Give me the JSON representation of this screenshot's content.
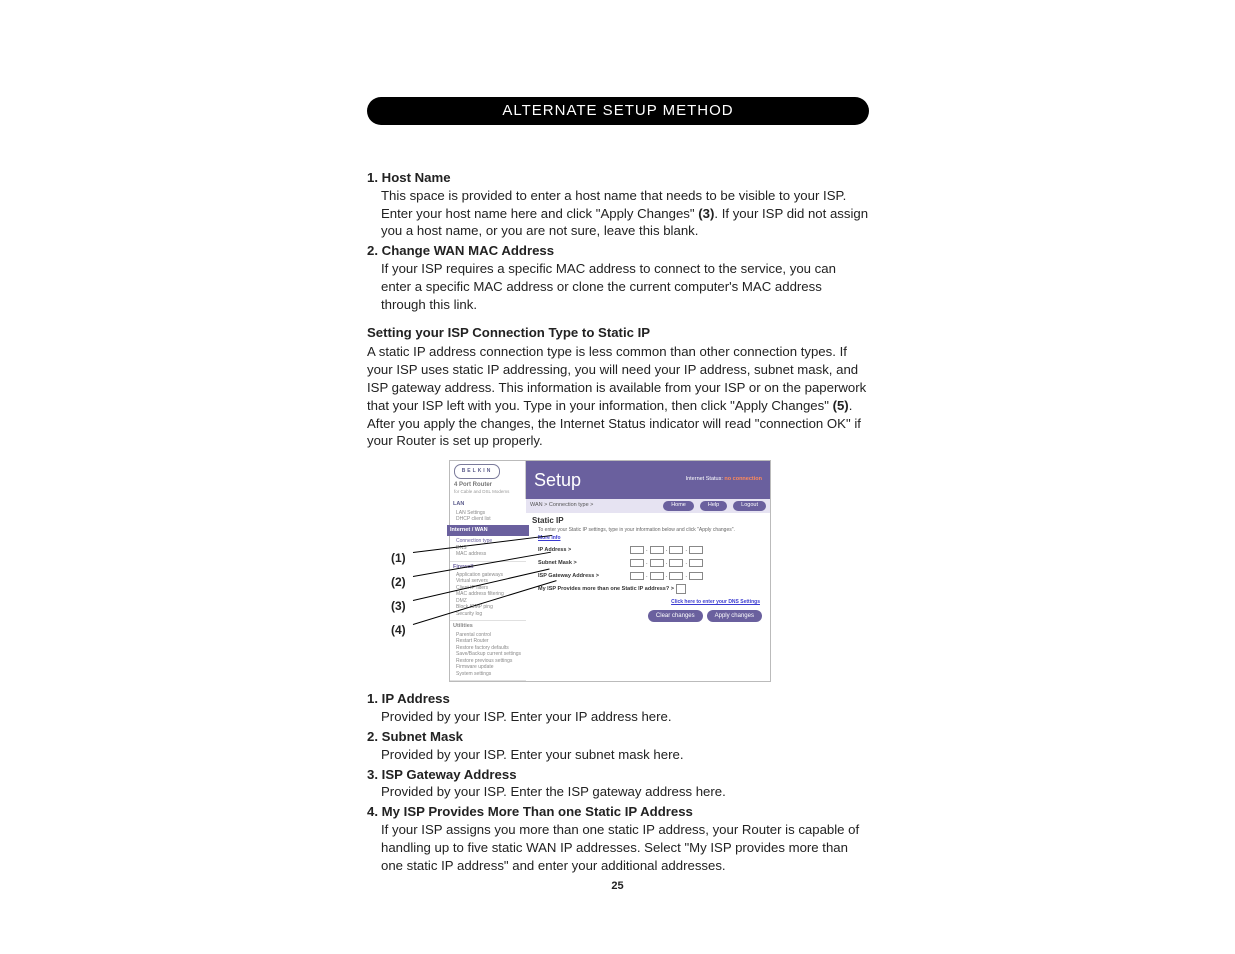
{
  "header": "ALTERNATE SETUP METHOD",
  "list1": {
    "i1": {
      "num": "1.",
      "title": "Host Name",
      "body_a": "This space is provided to enter a host name that needs to be visible to your ISP. Enter your host name here and click \"Apply Changes\" ",
      "ref": "(3)",
      "body_b": ". If your ISP did not assign you a host name, or you are not sure, leave this blank."
    },
    "i2": {
      "num": "2.",
      "title": "Change WAN MAC Address",
      "body": "If your ISP requires a specific MAC address to connect to the service, you can enter a specific MAC address or clone the current computer's MAC address through this link."
    }
  },
  "section": {
    "heading": "Setting your ISP Connection Type to Static IP",
    "p_a": "A static IP address connection type is less common than other connection types. If your ISP uses static IP addressing, you will need your IP address, subnet mask, and ISP gateway address. This information is available from your ISP or on the paperwork that your ISP left with you. Type in your information, then click \"Apply Changes\" ",
    "ref": "(5)",
    "p_b": ". After you apply the changes, the Internet Status indicator will read \"connection OK\" if your Router is set up properly."
  },
  "callouts": {
    "c1": "(1)",
    "c2": "(2)",
    "c3": "(3)",
    "c4": "(4)"
  },
  "router": {
    "logo": "BELKIN",
    "logo_sub": "4 Port Router",
    "logo_sub2": "for Cable and DSL Modems",
    "banner_title": "Setup",
    "status_label": "Internet Status:",
    "status_value": "no connection",
    "crumb": "WAN > Connection type >",
    "pills": {
      "home": "Home",
      "help": "Help",
      "logout": "Logout"
    },
    "side": {
      "lan": {
        "h": "LAN",
        "items": [
          "LAN Settings",
          "DHCP client list"
        ]
      },
      "wan": {
        "h": "Internet / WAN",
        "items": [
          "Connection type",
          "DNS",
          "MAC address"
        ]
      },
      "fw": {
        "h": "Firewall",
        "items": [
          "Application gateways",
          "Virtual servers",
          "Client IP filters",
          "MAC address filtering",
          "DMZ",
          "Block ICMP ping",
          "Security log"
        ]
      },
      "util": {
        "h": "Utilities",
        "items": [
          "Parental control",
          "Restart Router",
          "Restore factory defaults",
          "Save/Backup current settings",
          "Restore previous settings",
          "Firmware update",
          "System settings"
        ]
      }
    },
    "main": {
      "title": "Static IP",
      "sub": "To enter your Static IP settings, type in your information below and click \"Apply changes\".",
      "more": "More Info",
      "rows": {
        "ip": "IP Address >",
        "mask": "Subnet Mask >",
        "gw": "ISP Gateway Address >",
        "multi": "My ISP Provides more than one Static IP address? >"
      },
      "dns_note": "Click here to enter your DNS Settings",
      "btn_clear": "Clear changes",
      "btn_apply": "Apply changes"
    }
  },
  "list2": {
    "i1": {
      "num": "1.",
      "title": "IP Address",
      "body": "Provided by your ISP. Enter your IP address here."
    },
    "i2": {
      "num": "2.",
      "title": "Subnet Mask",
      "body": "Provided by your ISP. Enter your subnet mask here."
    },
    "i3": {
      "num": "3.",
      "title": "ISP Gateway Address",
      "body": "Provided by your ISP. Enter the ISP gateway address here."
    },
    "i4": {
      "num": "4.",
      "title": "My ISP Provides More Than one Static IP Address",
      "body": "If your ISP assigns you more than one static IP address, your Router is capable of handling up to five static WAN IP addresses. Select \"My ISP provides more than one static IP address\" and enter your additional addresses."
    }
  },
  "pagenum": "25"
}
